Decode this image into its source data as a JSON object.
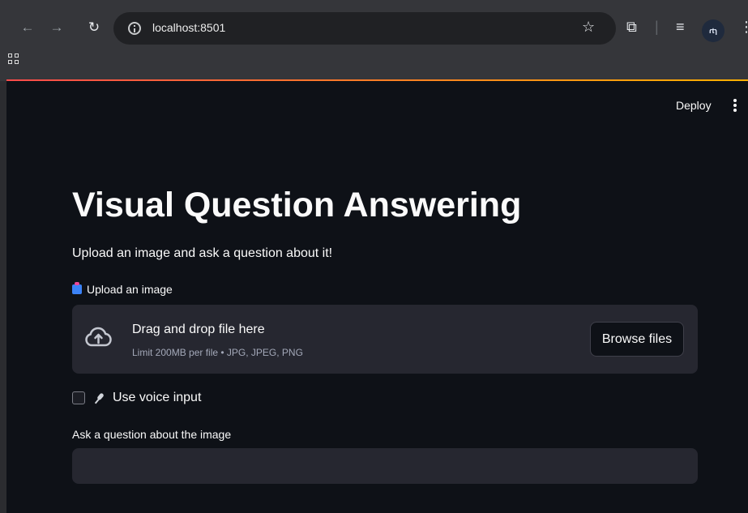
{
  "browser": {
    "url": "localhost:8501",
    "profile_initials": "ɾtɿ",
    "icons": [
      "back-arrow-icon",
      "forward-arrow-icon",
      "reload-icon",
      "info-icon",
      "star-icon",
      "extensions-icon",
      "reading-list-icon",
      "menu-dots-icon"
    ]
  },
  "app": {
    "deploy_label": "Deploy",
    "title": "Visual Question Answering",
    "subtitle": "Upload an image and ask a question about it!",
    "upload": {
      "label": "Upload an image",
      "drag_text": "Drag and drop file here",
      "limit_text": "Limit 200MB per file • JPG, JPEG, PNG",
      "browse_label": "Browse files"
    },
    "voice": {
      "label": "Use voice input",
      "checked": false
    },
    "question": {
      "label": "Ask a question about the image",
      "value": "",
      "placeholder": ""
    }
  },
  "colors": {
    "background": "#0e1117",
    "panel": "#262730",
    "text": "#fafafa",
    "accent_start": "#ff4b4b",
    "accent_end": "#ffb000"
  }
}
